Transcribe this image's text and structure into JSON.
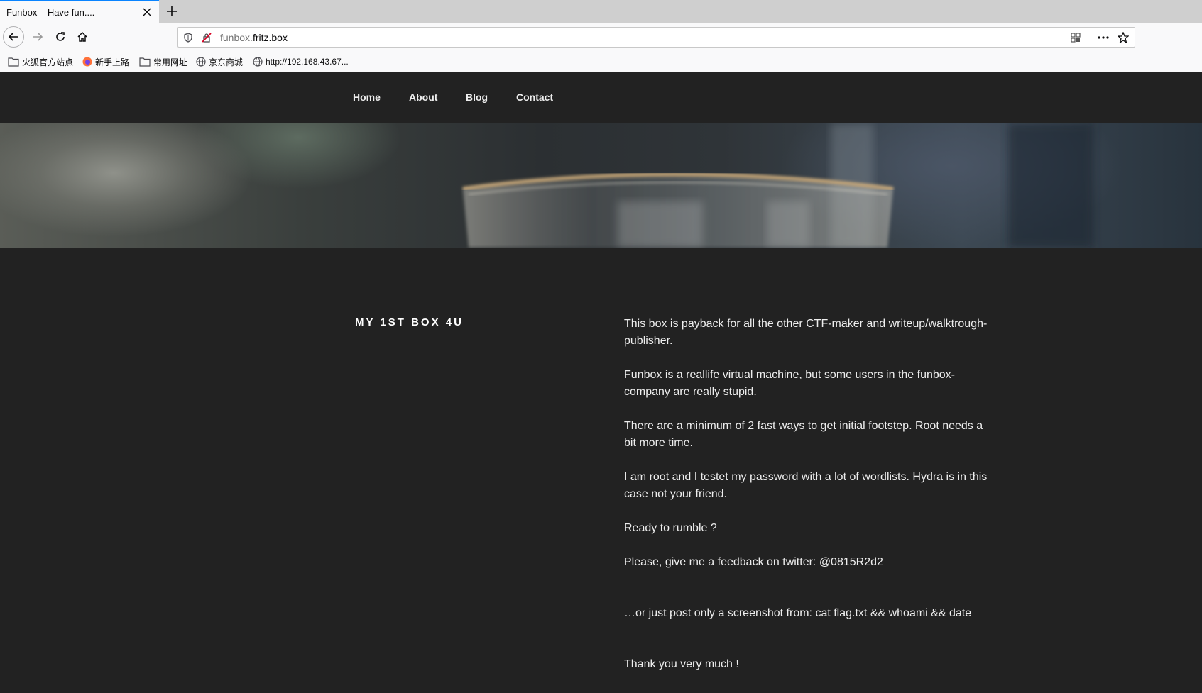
{
  "browser": {
    "tab": {
      "title": "Funbox – Have fun....",
      "close_icon": "close-icon"
    },
    "url": {
      "host_prefix": "funbox.",
      "host_domain": "fritz.box"
    },
    "bookmarks": [
      {
        "label": "火狐官方站点",
        "icon": "folder-icon"
      },
      {
        "label": "新手上路",
        "icon": "firefox-icon"
      },
      {
        "label": "常用网址",
        "icon": "folder-icon"
      },
      {
        "label": "京东商城",
        "icon": "globe-icon"
      },
      {
        "label": "http://192.168.43.67...",
        "icon": "globe-icon"
      }
    ]
  },
  "site": {
    "menu": [
      "Home",
      "About",
      "Blog",
      "Contact"
    ],
    "title": "MY 1ST BOX 4U",
    "paragraphs": [
      "This box is payback for all the other CTF-maker and writeup/walktrough-publisher.",
      "Funbox is a reallife virtual machine, but some users in the funbox-company are really stupid.",
      "There are a minimum of 2 fast ways to get initial footstep. Root needs a bit more time.",
      "I am root and I testet my password with a lot of wordlists. Hydra is in this case not your friend.",
      "Ready to rumble ?",
      "Please, give me a feedback on twitter: @0815R2d2",
      "…or just post only a screenshot from: cat flag.txt && whoami && date",
      "Thank you very much !"
    ]
  }
}
